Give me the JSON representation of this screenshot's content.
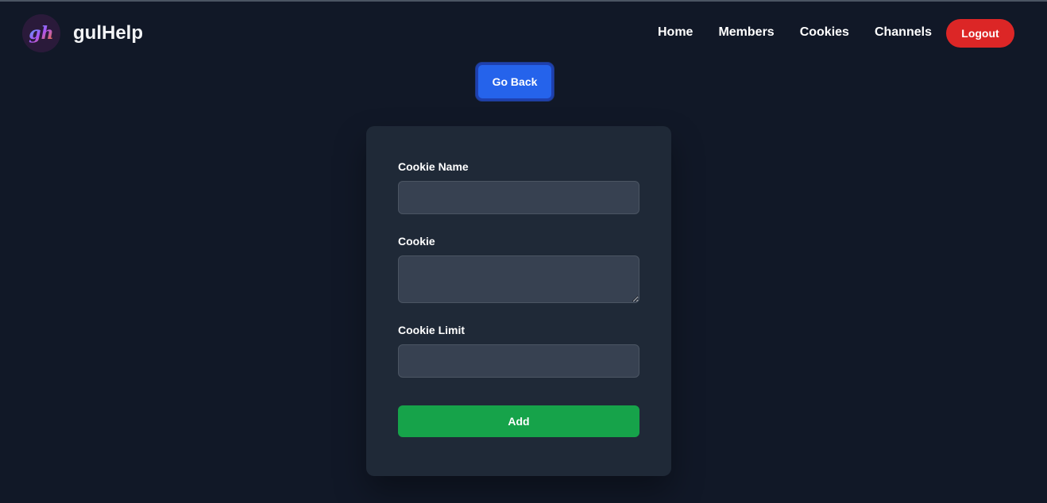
{
  "brand": {
    "logo_text": "gh",
    "name": "gulHelp"
  },
  "nav": {
    "links": [
      "Home",
      "Members",
      "Cookies",
      "Channels"
    ],
    "logout_label": "Logout"
  },
  "go_back_label": "Go Back",
  "form": {
    "fields": [
      {
        "label": "Cookie Name",
        "value": ""
      },
      {
        "label": "Cookie",
        "value": ""
      },
      {
        "label": "Cookie Limit",
        "value": ""
      }
    ],
    "submit_label": "Add"
  },
  "colors": {
    "background": "#111827",
    "card": "#1f2937",
    "input": "#374151",
    "primary": "#2563eb",
    "danger": "#dc2626",
    "success": "#16a34a"
  }
}
